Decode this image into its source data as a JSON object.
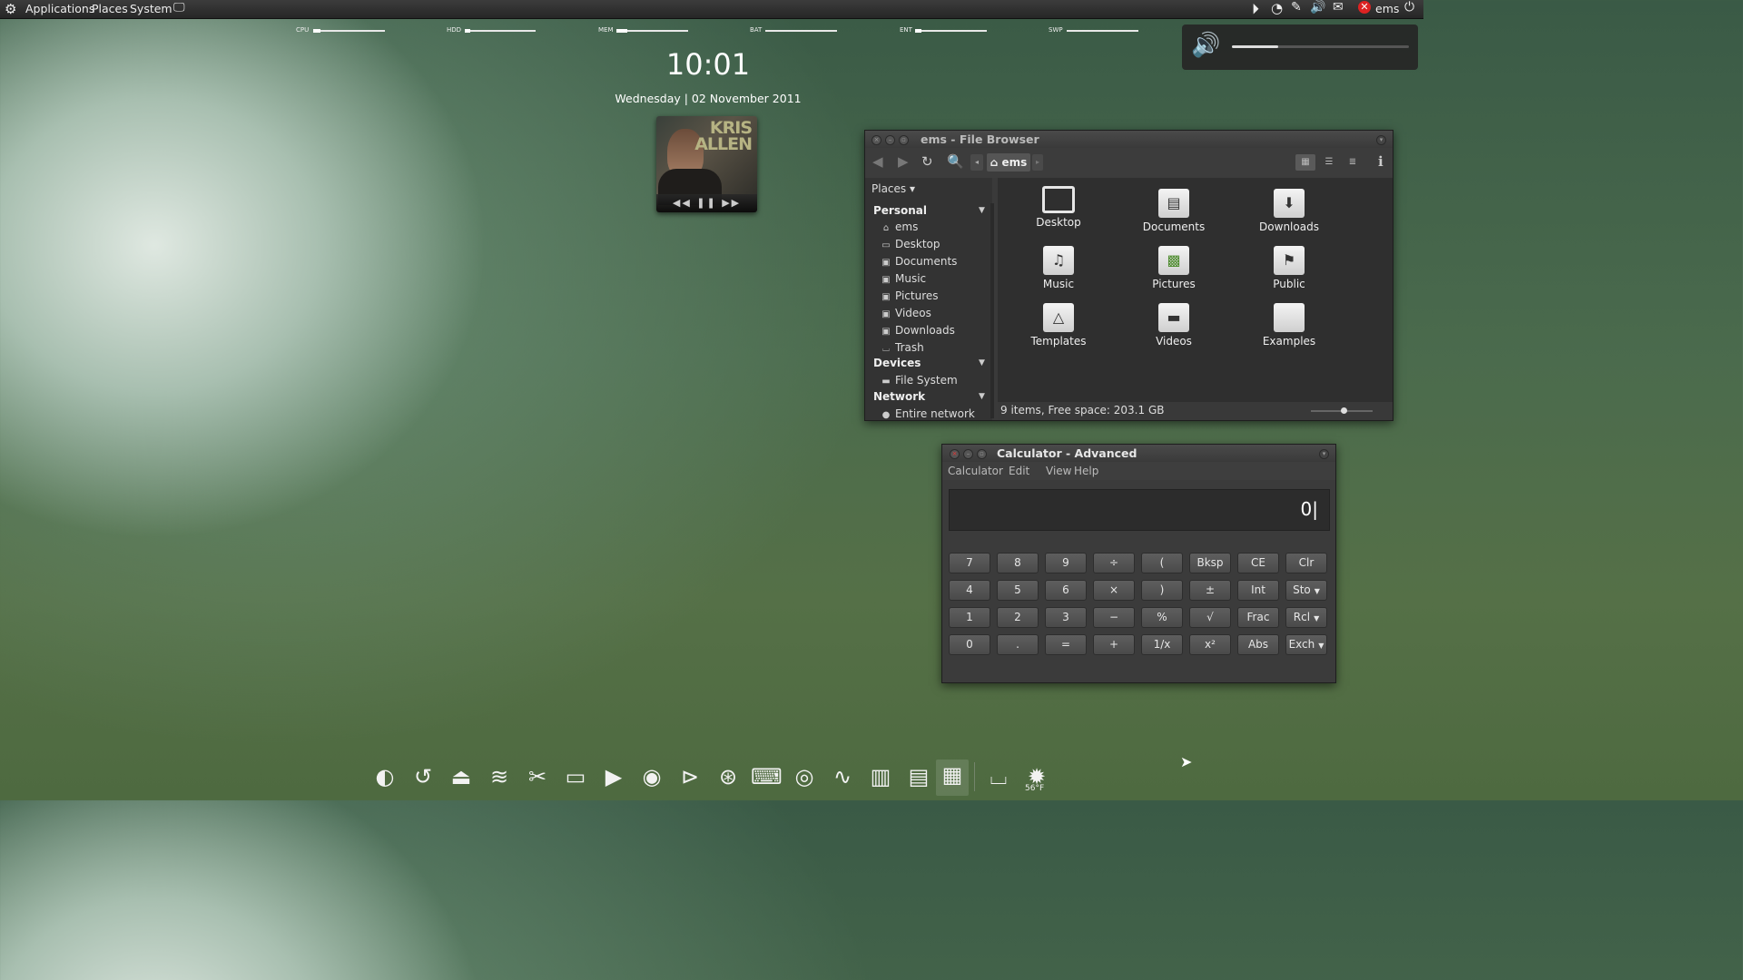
{
  "top_panel": {
    "menus": [
      "Applications",
      "Places",
      "System"
    ],
    "user": "ems",
    "tray_icons": [
      "media-play-icon",
      "sync-icon",
      "pen-icon",
      "volume-icon",
      "mail-icon",
      "user-status-icon",
      "power-icon"
    ]
  },
  "meters": [
    {
      "label": "CPU",
      "level": 0.1
    },
    {
      "label": "HDD",
      "level": 0.08
    },
    {
      "label": "MEM",
      "level": 0.15
    },
    {
      "label": "BAT",
      "level": 0.0
    },
    {
      "label": "ENT",
      "level": 0.08
    },
    {
      "label": "SWP",
      "level": 0.0
    }
  ],
  "clock": {
    "time": "10:01",
    "date": "Wednesday | 02 November 2011"
  },
  "album": {
    "artist_line1": "KRIS",
    "artist_line2": "ALLEN",
    "controls": "◀◀ ❚❚ ▶▶"
  },
  "volume": {
    "level": 0.26
  },
  "file_browser": {
    "title": "ems - File Browser",
    "breadcrumb": "ems",
    "places_label": "Places",
    "sections": {
      "personal": "Personal",
      "devices": "Devices",
      "network": "Network"
    },
    "personal_items": [
      "ems",
      "Desktop",
      "Documents",
      "Music",
      "Pictures",
      "Videos",
      "Downloads",
      "Trash"
    ],
    "device_items": [
      "File System"
    ],
    "network_items": [
      "Entire network"
    ],
    "files": [
      "Desktop",
      "Documents",
      "Downloads",
      "Music",
      "Pictures",
      "Public",
      "Templates",
      "Videos",
      "Examples"
    ],
    "status": "9 items, Free space: 203.1 GB"
  },
  "calculator": {
    "title": "Calculator - Advanced",
    "menu": [
      "Calculator",
      "Edit",
      "View",
      "Help"
    ],
    "display": "0",
    "keys": [
      [
        "7",
        "8",
        "9",
        "÷",
        "(",
        "Bksp",
        "CE",
        "Clr"
      ],
      [
        "4",
        "5",
        "6",
        "×",
        ")",
        "±",
        "Int",
        "Sto"
      ],
      [
        "1",
        "2",
        "3",
        "−",
        "%",
        "√",
        "Frac",
        "Rcl"
      ],
      [
        "0",
        ".",
        "=",
        "+",
        "1/x",
        "x²",
        "Abs",
        "Exch"
      ]
    ]
  },
  "dock": {
    "items": [
      "firefox-icon",
      "thunderbird-icon",
      "installer-icon",
      "draw-icon",
      "video-editor-icon",
      "remote-desktop-icon",
      "media-player-icon",
      "sync-client-icon",
      "music-player-icon",
      "network-icon",
      "terminal-icon",
      "nvidia-icon",
      "system-monitor-icon",
      "disk-icon",
      "file-manager-icon",
      "calculator-icon",
      "trash-icon",
      "weather-icon"
    ],
    "weather_temp": "56°F"
  }
}
